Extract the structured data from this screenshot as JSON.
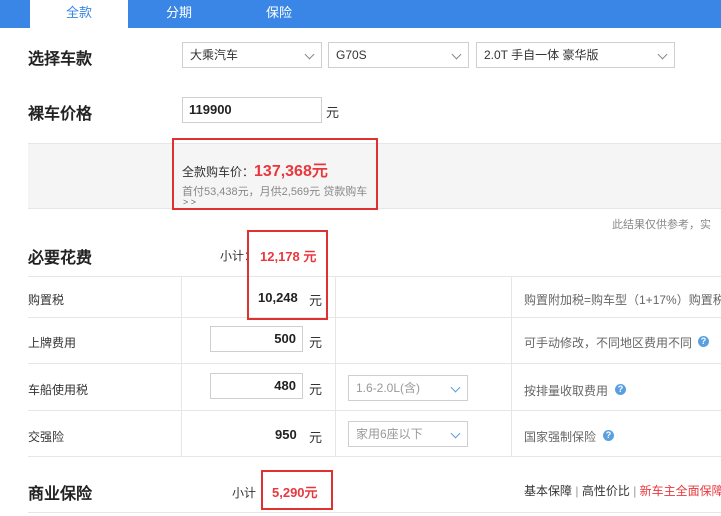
{
  "tabs": [
    {
      "label": "全款"
    },
    {
      "label": "分期"
    },
    {
      "label": "保险"
    }
  ],
  "select_model": {
    "title": "选择车款",
    "brand": "大乘汽车",
    "series": "G70S",
    "trim": "2.0T 手自一体 豪华版"
  },
  "bare_price": {
    "title": "裸车价格",
    "value": "119900",
    "unit": "元"
  },
  "summary": {
    "total_label": "全款购车价：",
    "total_value": "137,368元",
    "loan_text": "首付53,438元，月供2,569元 贷款购车",
    "loan_arrow": "> >",
    "disclaimer": "此结果仅供参考，实"
  },
  "required": {
    "title": "必要花费",
    "subtotal_label": "小计：",
    "subtotal_value": "12,178 元",
    "rows": [
      {
        "name": "购置税",
        "value": "10,248",
        "unit": "元",
        "note": "购置附加税=购车型（1+17%）购置税"
      },
      {
        "name": "上牌费用",
        "value": "500",
        "unit": "元",
        "note": "可手动修改，不同地区费用不同"
      },
      {
        "name": "车船使用税",
        "value": "480",
        "unit": "元",
        "option": "1.6-2.0L(含)",
        "note": "按排量收取费用"
      },
      {
        "name": "交强险",
        "value": "950",
        "unit": "元",
        "option": "家用6座以下",
        "note": "国家强制保险"
      }
    ]
  },
  "commercial": {
    "title": "商业保险",
    "subtotal_label": "小计",
    "subtotal_value": "5,290元",
    "links": [
      "基本保障",
      "高性价比",
      "新车主全面保障"
    ],
    "separator": "|"
  },
  "colors": {
    "tab_blue": "#3a86e6",
    "accent_red": "#e8383d",
    "help_blue": "#5aa0e0"
  }
}
